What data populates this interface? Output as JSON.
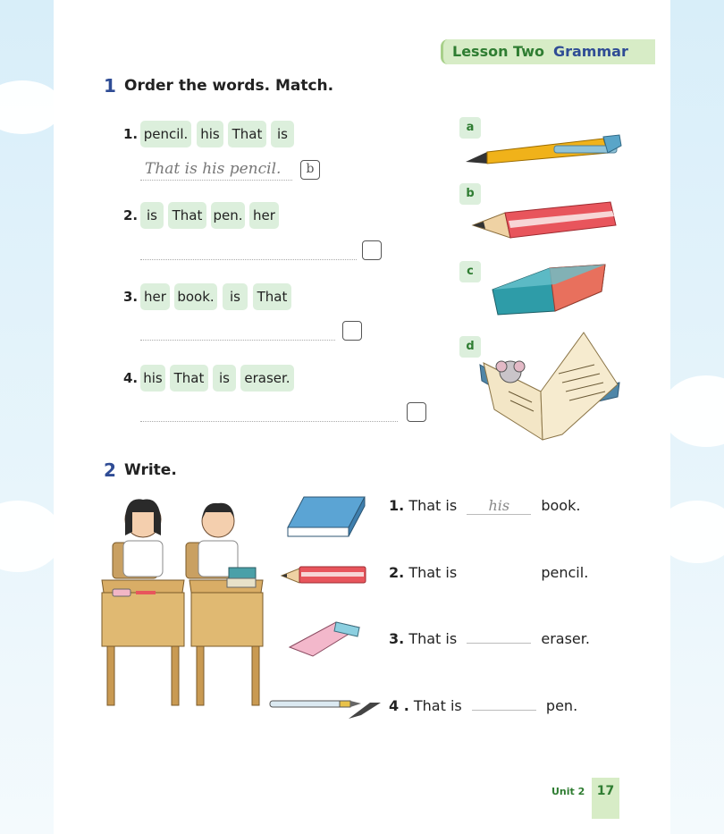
{
  "header": {
    "lesson": "Lesson Two",
    "topic": "Grammar"
  },
  "section1": {
    "number": "1",
    "title": "Order the words. Match.",
    "items": [
      {
        "num": "1.",
        "words": [
          "pencil.",
          "his",
          "That",
          "is"
        ],
        "answer": "That is his pencil.",
        "match": "b"
      },
      {
        "num": "2.",
        "words": [
          "is",
          "That",
          "pen.",
          "her"
        ],
        "answer": "",
        "match": ""
      },
      {
        "num": "3.",
        "words": [
          "her",
          "book.",
          "is",
          "That"
        ],
        "answer": "",
        "match": ""
      },
      {
        "num": "4.",
        "words": [
          "his",
          "That",
          "is",
          "eraser."
        ],
        "answer": "",
        "match": ""
      }
    ],
    "pictures": [
      {
        "letter": "a",
        "icon": "pen-icon"
      },
      {
        "letter": "b",
        "icon": "pencil-icon"
      },
      {
        "letter": "c",
        "icon": "eraser-icon"
      },
      {
        "letter": "d",
        "icon": "open-book-icon"
      }
    ]
  },
  "section2": {
    "number": "2",
    "title": "Write.",
    "sentences": [
      {
        "num": "1.",
        "start": "That is",
        "fill": "his",
        "end": "book."
      },
      {
        "num": "2.",
        "start": "That is",
        "fill": "",
        "end": "pencil."
      },
      {
        "num": "3.",
        "start": "That is",
        "fill": "",
        "end": "eraser."
      },
      {
        "num": "4 .",
        "start": "That is",
        "fill": "",
        "end": "pen."
      }
    ]
  },
  "footer": {
    "unit": "Unit 2",
    "page": "17"
  }
}
